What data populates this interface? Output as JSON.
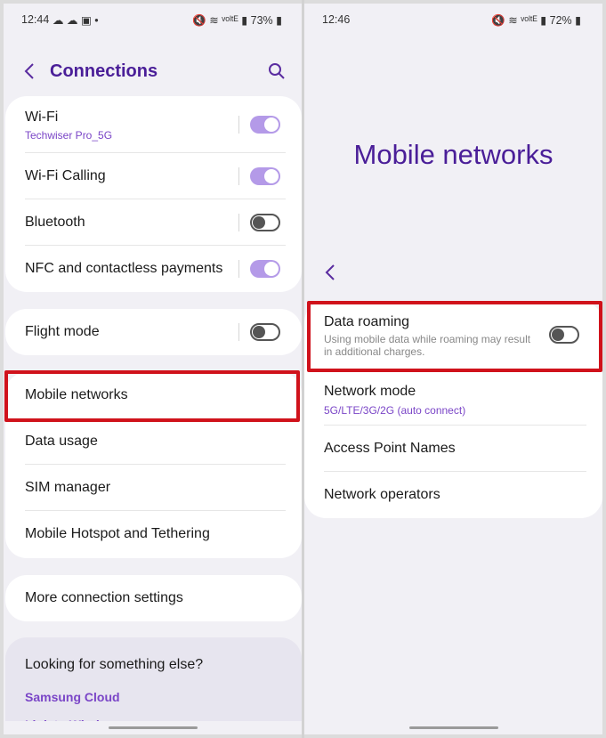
{
  "left": {
    "status": {
      "time": "12:44",
      "icons": "☁ ☁ ▣ •",
      "right": "🔇 ≋ ᵛᵒˡᵗᴱ ▮ 73% ▮"
    },
    "title": "Connections",
    "card1": [
      {
        "label": "Wi-Fi",
        "sub": "Techwiser Pro_5G",
        "toggle": "on"
      },
      {
        "label": "Wi-Fi Calling",
        "toggle": "on"
      },
      {
        "label": "Bluetooth",
        "toggle": "off"
      },
      {
        "label": "NFC and contactless payments",
        "toggle": "on"
      }
    ],
    "flight_mode": {
      "label": "Flight mode",
      "toggle": "off"
    },
    "card3": [
      {
        "label": "Mobile networks"
      },
      {
        "label": "Data usage"
      },
      {
        "label": "SIM manager"
      },
      {
        "label": "Mobile Hotspot and Tethering"
      }
    ],
    "more": "More connection settings",
    "looking": {
      "heading": "Looking for something else?",
      "link": "Samsung Cloud",
      "link2": "Link to Windows"
    }
  },
  "right": {
    "status": {
      "time": "12:46",
      "right": "🔇 ≋ ᵛᵒˡᵗᴱ ▮ 72% ▮"
    },
    "title": "Mobile networks",
    "items": [
      {
        "label": "Data roaming",
        "sub": "Using mobile data while roaming may result in additional charges.",
        "toggle": "off"
      },
      {
        "label": "Network mode",
        "sub": "5G/LTE/3G/2G (auto connect)"
      },
      {
        "label": "Access Point Names"
      },
      {
        "label": "Network operators"
      }
    ]
  },
  "colors": {
    "accent": "#5a2ca0",
    "highlight": "#d0121b",
    "toggle_on": "#b49ae8"
  }
}
